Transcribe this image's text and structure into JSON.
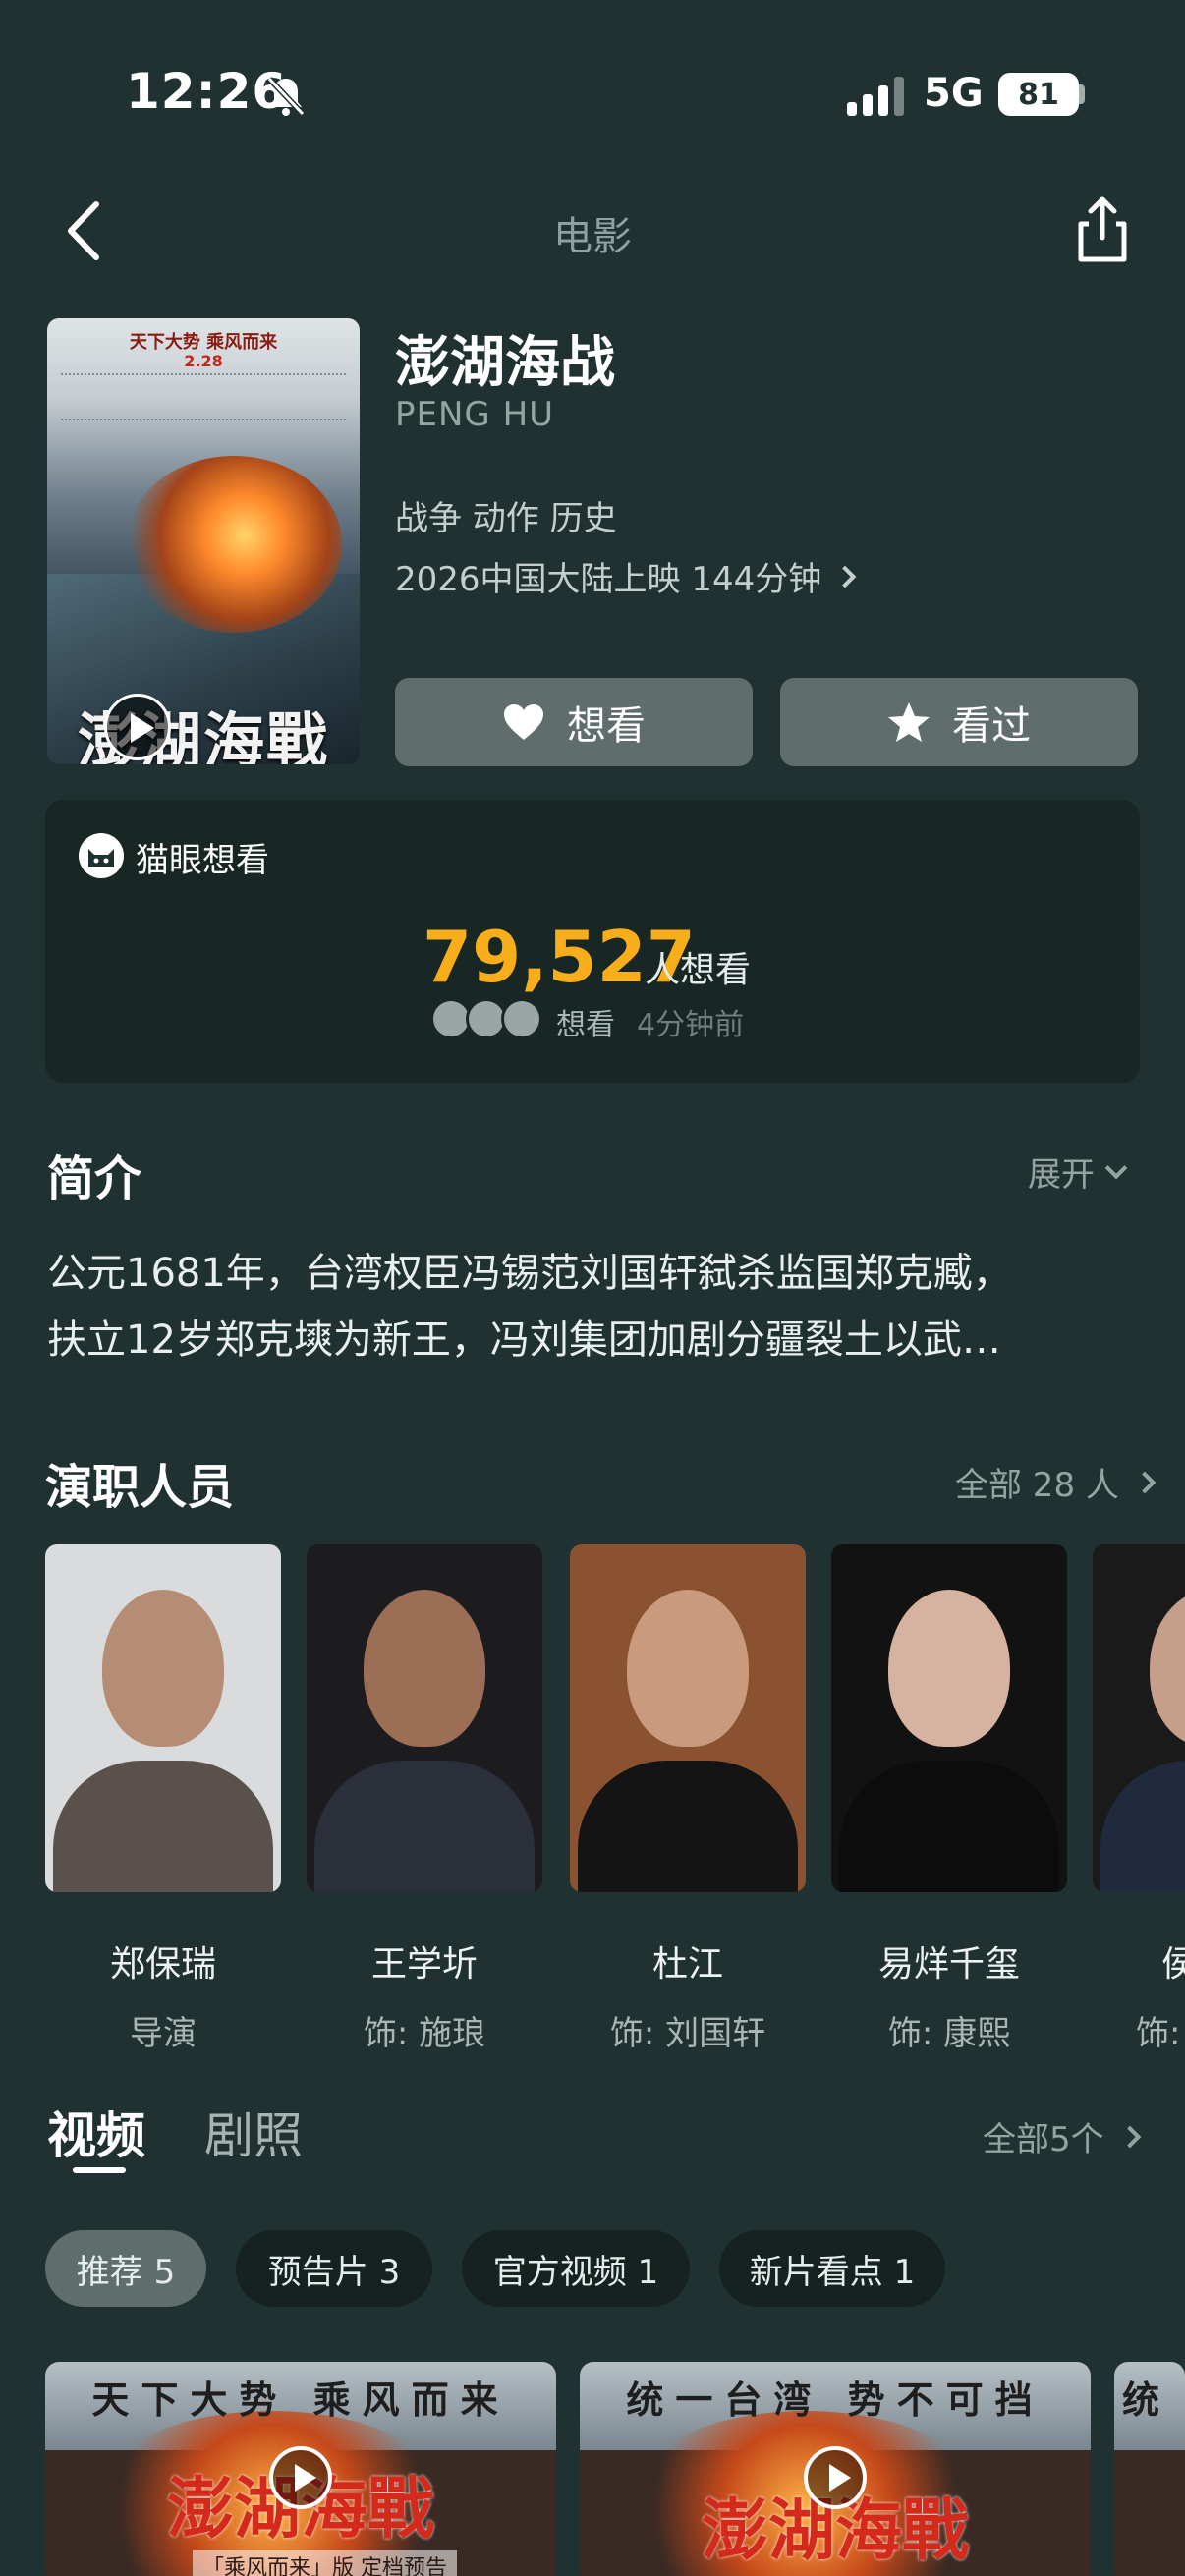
{
  "status_bar": {
    "time": "12:26",
    "network": "5G",
    "battery": "81",
    "icons": [
      "bell-muted-icon",
      "signal-icon",
      "battery-icon"
    ]
  },
  "nav": {
    "title": "电影",
    "back_icon": "chevron-left-icon",
    "share_icon": "share-icon"
  },
  "movie": {
    "title": "澎湖海战",
    "english_title": "PENG HU",
    "genres": "战争 动作 历史",
    "release_info": "2026中国大陆上映 144分钟",
    "poster": {
      "tagline": "天下大势 乘风而来",
      "red_text": "2.28",
      "big_title": "澎湖海戰"
    }
  },
  "actions": {
    "want_label": "想看",
    "seen_label": "看过",
    "want_icon": "heart-icon",
    "seen_icon": "star-icon"
  },
  "want_card": {
    "label": "猫眼想看",
    "count": "79,527",
    "count_unit": "人想看",
    "recent_label": "想看",
    "recent_time": "4分钟前",
    "accent_color": "#f7ae1a"
  },
  "intro": {
    "title": "简介",
    "expand_label": "展开",
    "text_line1": "公元1681年，台湾权臣冯锡范刘国轩弑杀监国郑克臧，",
    "text_line2": "扶立12岁郑克塽为新王，冯刘集团加剧分疆裂土以武…"
  },
  "cast": {
    "title": "演职人员",
    "all_label": "全部 28 人",
    "members": [
      {
        "name": "郑保瑞",
        "role": "导演"
      },
      {
        "name": "王学圻",
        "role": "饰: 施琅"
      },
      {
        "name": "杜江",
        "role": "饰: 刘国轩"
      },
      {
        "name": "易烊千玺",
        "role": "饰: 康熙"
      },
      {
        "name": "侯",
        "role": "饰:"
      }
    ]
  },
  "videos": {
    "tab_video": "视频",
    "tab_stills": "剧照",
    "all_label": "全部5个",
    "chips": [
      {
        "label": "推荐 5"
      },
      {
        "label": "预告片 3"
      },
      {
        "label": "官方视频 1"
      },
      {
        "label": "新片看点 1"
      }
    ],
    "thumbs": [
      {
        "slogan": "天下大势 乘风而来",
        "title": "澎湖海戰",
        "caption": "「乘风而来」版 定档预告"
      },
      {
        "slogan": "统一台湾 势不可挡",
        "title": "澎湖海戰",
        "caption": ""
      },
      {
        "slogan": "统",
        "title": "",
        "caption": ""
      }
    ]
  }
}
